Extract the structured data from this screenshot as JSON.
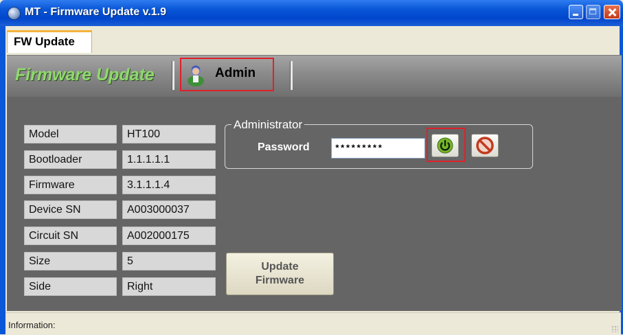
{
  "window": {
    "title": "MT - Firmware Update v.1.9"
  },
  "tabs": [
    {
      "label": "FW Update",
      "active": true
    }
  ],
  "toolbar": {
    "title": "Firmware Update",
    "admin_label": "Admin"
  },
  "device_info": [
    {
      "label": "Model",
      "value": "HT100"
    },
    {
      "label": "Bootloader",
      "value": "1.1.1.1.1"
    },
    {
      "label": "Firmware",
      "value": "3.1.1.1.4"
    },
    {
      "label": "Device SN",
      "value": "A003000037"
    },
    {
      "label": "Circuit SN",
      "value": "A002000175"
    },
    {
      "label": "Size",
      "value": "5"
    },
    {
      "label": "Side",
      "value": "Right"
    }
  ],
  "admin_group": {
    "legend": "Administrator",
    "password_label": "Password",
    "password_value": "*********",
    "ok_icon": "power-icon",
    "cancel_icon": "cancel-icon"
  },
  "update_button": {
    "line1": "Update",
    "line2": "Firmware"
  },
  "status": {
    "text": "Information:"
  },
  "colors": {
    "titlebar": "#0a57d8",
    "toolbar_title": "#8fd86e",
    "highlight": "#e0202a",
    "content_bg": "#656565"
  }
}
